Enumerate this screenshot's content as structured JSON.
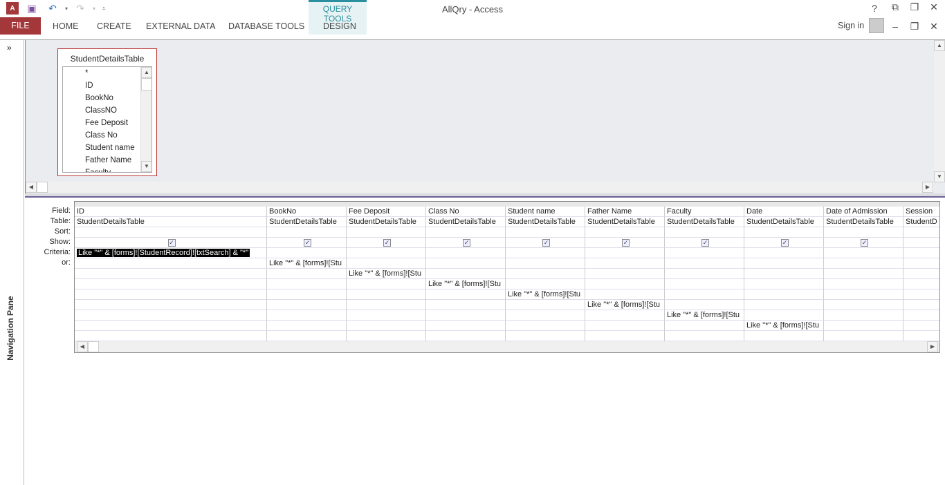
{
  "app": {
    "title": "AllQry - Access",
    "qat": [
      "access-logo-icon",
      "save-icon",
      "undo-icon",
      "redo-icon",
      "customize-icon"
    ]
  },
  "ribbon": {
    "file": "FILE",
    "tabs": [
      "HOME",
      "CREATE",
      "EXTERNAL DATA",
      "DATABASE TOOLS"
    ],
    "context_group": "QUERY TOOLS",
    "context_tab": "DESIGN",
    "sign_in": "Sign in",
    "help": "?"
  },
  "nav_pane": {
    "label": "Navigation Pane",
    "toggle": "»"
  },
  "table_box": {
    "title": "StudentDetailsTable",
    "fields": [
      "*",
      "ID",
      "BookNo",
      "ClassNO",
      "Fee Deposit",
      "Class No",
      "Student name",
      "Father Name",
      "Faculty"
    ]
  },
  "grid": {
    "row_labels": [
      "Field:",
      "Table:",
      "Sort:",
      "Show:",
      "Criteria:",
      "or:"
    ],
    "columns": [
      {
        "field": "ID",
        "table": "StudentDetailsTable",
        "show": true,
        "criteria_row": 4,
        "criteria": "Like \"*\" & [forms]![StudentRecord]![txtSearch] & \"*\""
      },
      {
        "field": "BookNo",
        "table": "StudentDetailsTable",
        "show": true,
        "criteria_row": 5,
        "criteria": "Like \"*\" & [forms]![Stu"
      },
      {
        "field": "Fee Deposit",
        "table": "StudentDetailsTable",
        "show": true,
        "criteria_row": 6,
        "criteria": "Like \"*\" & [forms]![Stu"
      },
      {
        "field": "Class No",
        "table": "StudentDetailsTable",
        "show": true,
        "criteria_row": 7,
        "criteria": "Like \"*\" & [forms]![Stu"
      },
      {
        "field": "Student name",
        "table": "StudentDetailsTable",
        "show": true,
        "criteria_row": 8,
        "criteria": "Like \"*\" & [forms]![Stu"
      },
      {
        "field": "Father Name",
        "table": "StudentDetailsTable",
        "show": true,
        "criteria_row": 9,
        "criteria": "Like \"*\" & [forms]![Stu"
      },
      {
        "field": "Faculty",
        "table": "StudentDetailsTable",
        "show": true,
        "criteria_row": 10,
        "criteria": "Like \"*\" & [forms]![Stu"
      },
      {
        "field": "Date",
        "table": "StudentDetailsTable",
        "show": true,
        "criteria_row": 11,
        "criteria": "Like \"*\" & [forms]![Stu"
      },
      {
        "field": "Date of Admission",
        "table": "StudentDetailsTable",
        "show": true,
        "criteria_row": null,
        "criteria": ""
      },
      {
        "field": "Session",
        "table": "StudentD",
        "show": true,
        "criteria_row": null,
        "criteria": ""
      }
    ]
  }
}
